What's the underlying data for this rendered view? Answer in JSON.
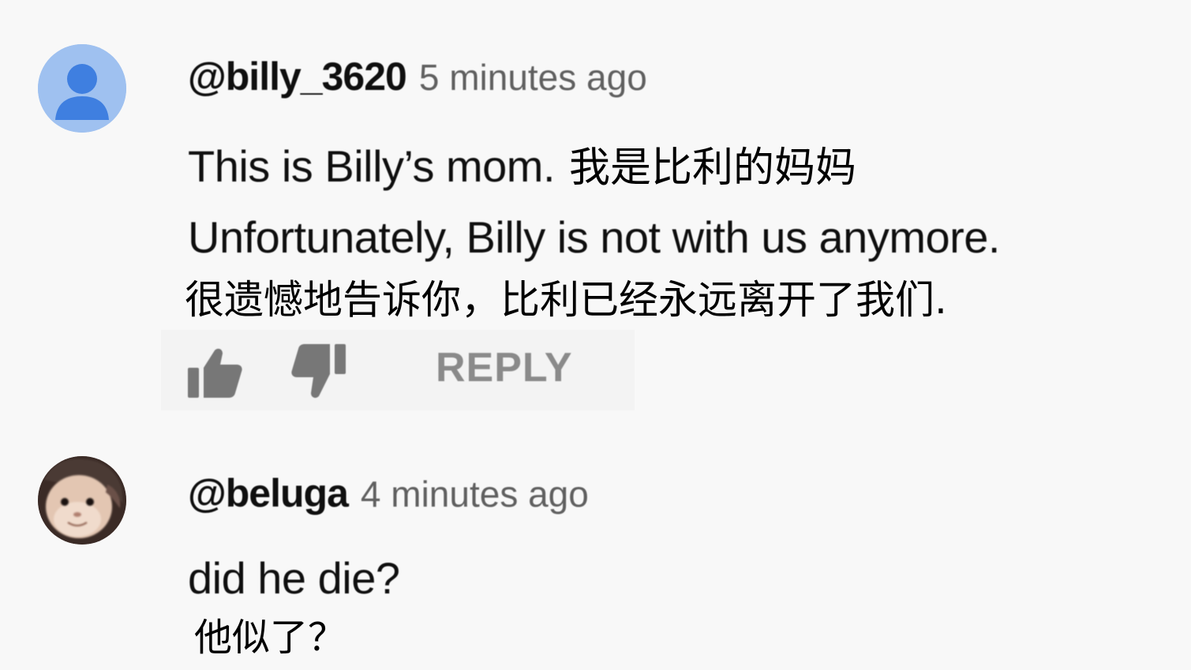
{
  "comments": [
    {
      "author": "@billy_3620",
      "time": "5 minutes ago",
      "text_en_1": "This is Billy’s mom.",
      "text_zh_1": "我是比利的妈妈",
      "text_en_2": "Unfortunately, Billy is not with us anymore.",
      "text_zh_2": "很遗憾地告诉你，比利已经永远离开了我们.",
      "avatar_icon": "default-person-icon",
      "actions": {
        "like_icon": "thumbs-up-icon",
        "dislike_icon": "thumbs-down-icon",
        "reply_label": "REPLY"
      }
    },
    {
      "author": "@beluga",
      "time": "4 minutes ago",
      "text_en_1": "did he die?",
      "text_zh_1": "他似了？",
      "avatar_icon": "cat-face-avatar"
    }
  ],
  "colors": {
    "background": "#f8f8f8",
    "author": "#0f0f0f",
    "timestamp": "#606060",
    "reply": "#8a8a8a",
    "default_avatar_bg": "#9fc1f0",
    "default_avatar_fg": "#3f7fe0"
  }
}
